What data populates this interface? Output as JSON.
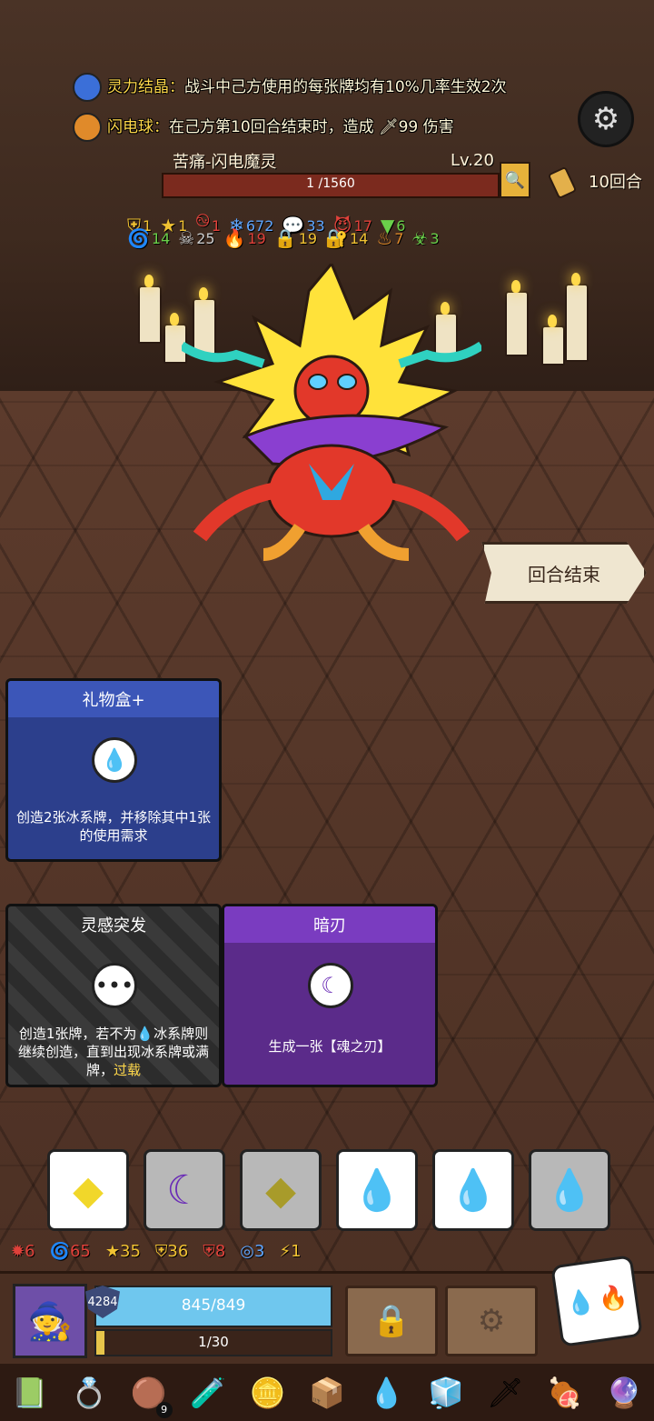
{
  "buffs": [
    {
      "icon": "crystal-icon",
      "title": "灵力结晶：",
      "text": "战斗中己方使用的每张牌均有10%几率生效2次"
    },
    {
      "icon": "lightning-orb-icon",
      "title": "闪电球：",
      "text": "在己方第10回合结束时，造成 🗡99 伤害"
    }
  ],
  "enemy": {
    "name": "苦痛-闪电魔灵",
    "level": "Lv.20",
    "hp": "1 /1560",
    "hp_fraction": 0.001
  },
  "turn_counter": "10回合",
  "enemy_status_row1": [
    {
      "icon": "shield-icon",
      "value": "1",
      "color": "#f1c232"
    },
    {
      "icon": "star-icon",
      "value": "1",
      "color": "#f1c232"
    },
    {
      "icon": "swirl-icon",
      "value": "1",
      "color": "#e0413a"
    },
    {
      "icon": "snowflake-icon",
      "value": "672",
      "color": "#5fa6ff"
    },
    {
      "icon": "speech-icon",
      "value": "33",
      "color": "#5fa6ff"
    },
    {
      "icon": "demon-icon",
      "value": "17",
      "color": "#e0413a"
    },
    {
      "icon": "triangle-icon",
      "value": "6",
      "color": "#6ad04a"
    }
  ],
  "enemy_status_row2": [
    {
      "icon": "spiral-icon",
      "value": "14",
      "color": "#6ad04a"
    },
    {
      "icon": "skull-icon",
      "value": "25",
      "color": "#cccccc"
    },
    {
      "icon": "fire-icon",
      "value": "19",
      "color": "#e0413a"
    },
    {
      "icon": "lock-icon",
      "value": "19",
      "color": "#f1c232"
    },
    {
      "icon": "padlock-icon",
      "value": "14",
      "color": "#f1c232"
    },
    {
      "icon": "flame-icon",
      "value": "7",
      "color": "#e08a2a"
    },
    {
      "icon": "poison-icon",
      "value": "3",
      "color": "#6ad04a"
    }
  ],
  "end_turn_label": "回合结束",
  "cards": [
    {
      "title": "礼物盒+",
      "icon": "water-drop-icon",
      "desc": "创造2张冰系牌，并移除其中1张的使用需求",
      "color": "#2c3f8c"
    },
    {
      "title": "灵感突发",
      "icon": "dots-icon",
      "desc_parts": [
        "创造1张牌，若不为",
        "💧",
        "冰系牌则继续创造，直到出现冰系牌或满牌，",
        "过载"
      ],
      "color": "#3a3a3a"
    },
    {
      "title": "暗刃",
      "icon": "moon-icon",
      "desc": "生成一张【魂之刃】",
      "color": "#5b2b8a"
    }
  ],
  "dice": [
    {
      "icon": "yellow-diamond-icon",
      "glyph": "◆",
      "color": "#f1d72a",
      "bg": "#ffffff"
    },
    {
      "icon": "purple-moon-icon",
      "glyph": "☾",
      "color": "#6a2cb6",
      "bg": "#b8b8b8"
    },
    {
      "icon": "yellow-diamond-icon",
      "glyph": "◆",
      "color": "#a89b2a",
      "bg": "#b8b8b8"
    },
    {
      "icon": "water-drop-icon",
      "glyph": "💧",
      "color": "#2b6fd8",
      "bg": "#ffffff"
    },
    {
      "icon": "water-drop-icon",
      "glyph": "💧",
      "color": "#2b6fd8",
      "bg": "#ffffff"
    },
    {
      "icon": "water-drop-icon",
      "glyph": "💧",
      "color": "#2b5ab0",
      "bg": "#b8b8b8"
    }
  ],
  "player_stats": [
    {
      "icon": "burst-icon",
      "value": "6",
      "color": "#e0413a"
    },
    {
      "icon": "spiral-icon",
      "value": "65",
      "color": "#e0413a"
    },
    {
      "icon": "star-icon",
      "value": "35",
      "color": "#f1c232"
    },
    {
      "icon": "shield-icon",
      "value": "36",
      "color": "#f1c232"
    },
    {
      "icon": "shield-icon",
      "value": "8",
      "color": "#e0413a"
    },
    {
      "icon": "target-icon",
      "value": "3",
      "color": "#5fa6ff"
    },
    {
      "icon": "lightning-icon",
      "value": "1",
      "color": "#f1c232"
    }
  ],
  "player": {
    "shield": "4284",
    "hp": "845/849",
    "exp": "1/30",
    "exp_fraction": 0.033
  },
  "inventory": [
    {
      "icon": "green-book-icon",
      "glyph": "📗"
    },
    {
      "icon": "gem-ring-icon",
      "glyph": "💍"
    },
    {
      "icon": "button-icon",
      "glyph": "🟤",
      "badge": "9"
    },
    {
      "icon": "potion-icon",
      "glyph": "🧪"
    },
    {
      "icon": "coin-icon",
      "glyph": "🪙"
    },
    {
      "icon": "box-icon",
      "glyph": "📦"
    },
    {
      "icon": "water-drop-icon",
      "glyph": "💧"
    },
    {
      "icon": "ice-cube-icon",
      "glyph": "🧊"
    },
    {
      "icon": "sword-icon",
      "glyph": "🗡"
    },
    {
      "icon": "meat-icon",
      "glyph": "🍖"
    },
    {
      "icon": "crystal-icon",
      "glyph": "🔮"
    }
  ]
}
